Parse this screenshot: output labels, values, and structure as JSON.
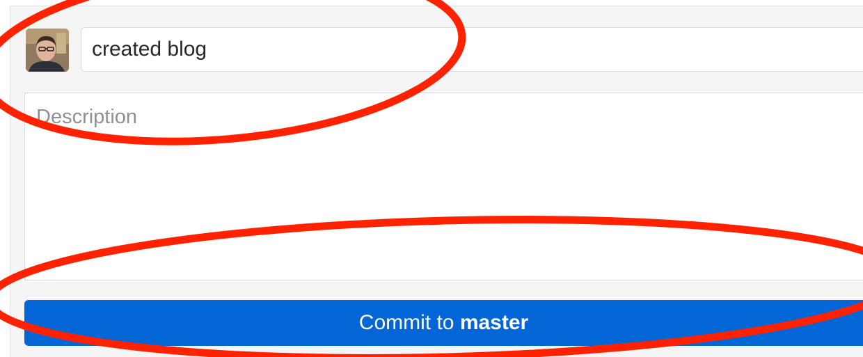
{
  "commit": {
    "summary_value": "created blog",
    "description_placeholder": "Description",
    "button": {
      "prefix": "Commit to ",
      "branch": "master"
    }
  },
  "colors": {
    "button_bg": "#0366d6",
    "annotation": "#ff2200",
    "panel_bg": "#f5f5f5"
  },
  "icons": {
    "avatar": "user-avatar"
  }
}
